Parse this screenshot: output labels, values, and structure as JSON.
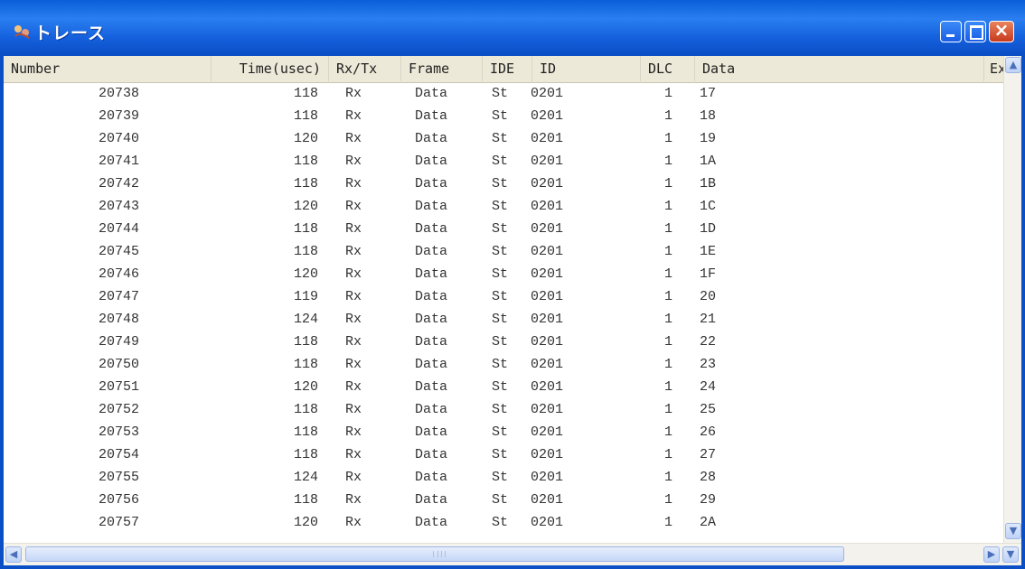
{
  "window": {
    "title": "トレース"
  },
  "columns": {
    "number": "Number",
    "time": "Time(usec)",
    "rxtx": "Rx/Tx",
    "frame": "Frame",
    "ide": "IDE",
    "id": "ID",
    "dlc": "DLC",
    "data": "Data",
    "extra": "Ex"
  },
  "rows": [
    {
      "number": "20738",
      "time": "118",
      "rxtx": "Rx",
      "frame": "Data",
      "ide": "St",
      "id": "0201",
      "dlc": "1",
      "data": "17"
    },
    {
      "number": "20739",
      "time": "118",
      "rxtx": "Rx",
      "frame": "Data",
      "ide": "St",
      "id": "0201",
      "dlc": "1",
      "data": "18"
    },
    {
      "number": "20740",
      "time": "120",
      "rxtx": "Rx",
      "frame": "Data",
      "ide": "St",
      "id": "0201",
      "dlc": "1",
      "data": "19"
    },
    {
      "number": "20741",
      "time": "118",
      "rxtx": "Rx",
      "frame": "Data",
      "ide": "St",
      "id": "0201",
      "dlc": "1",
      "data": "1A"
    },
    {
      "number": "20742",
      "time": "118",
      "rxtx": "Rx",
      "frame": "Data",
      "ide": "St",
      "id": "0201",
      "dlc": "1",
      "data": "1B"
    },
    {
      "number": "20743",
      "time": "120",
      "rxtx": "Rx",
      "frame": "Data",
      "ide": "St",
      "id": "0201",
      "dlc": "1",
      "data": "1C"
    },
    {
      "number": "20744",
      "time": "118",
      "rxtx": "Rx",
      "frame": "Data",
      "ide": "St",
      "id": "0201",
      "dlc": "1",
      "data": "1D"
    },
    {
      "number": "20745",
      "time": "118",
      "rxtx": "Rx",
      "frame": "Data",
      "ide": "St",
      "id": "0201",
      "dlc": "1",
      "data": "1E"
    },
    {
      "number": "20746",
      "time": "120",
      "rxtx": "Rx",
      "frame": "Data",
      "ide": "St",
      "id": "0201",
      "dlc": "1",
      "data": "1F"
    },
    {
      "number": "20747",
      "time": "119",
      "rxtx": "Rx",
      "frame": "Data",
      "ide": "St",
      "id": "0201",
      "dlc": "1",
      "data": "20"
    },
    {
      "number": "20748",
      "time": "124",
      "rxtx": "Rx",
      "frame": "Data",
      "ide": "St",
      "id": "0201",
      "dlc": "1",
      "data": "21"
    },
    {
      "number": "20749",
      "time": "118",
      "rxtx": "Rx",
      "frame": "Data",
      "ide": "St",
      "id": "0201",
      "dlc": "1",
      "data": "22"
    },
    {
      "number": "20750",
      "time": "118",
      "rxtx": "Rx",
      "frame": "Data",
      "ide": "St",
      "id": "0201",
      "dlc": "1",
      "data": "23"
    },
    {
      "number": "20751",
      "time": "120",
      "rxtx": "Rx",
      "frame": "Data",
      "ide": "St",
      "id": "0201",
      "dlc": "1",
      "data": "24"
    },
    {
      "number": "20752",
      "time": "118",
      "rxtx": "Rx",
      "frame": "Data",
      "ide": "St",
      "id": "0201",
      "dlc": "1",
      "data": "25"
    },
    {
      "number": "20753",
      "time": "118",
      "rxtx": "Rx",
      "frame": "Data",
      "ide": "St",
      "id": "0201",
      "dlc": "1",
      "data": "26"
    },
    {
      "number": "20754",
      "time": "118",
      "rxtx": "Rx",
      "frame": "Data",
      "ide": "St",
      "id": "0201",
      "dlc": "1",
      "data": "27"
    },
    {
      "number": "20755",
      "time": "124",
      "rxtx": "Rx",
      "frame": "Data",
      "ide": "St",
      "id": "0201",
      "dlc": "1",
      "data": "28"
    },
    {
      "number": "20756",
      "time": "118",
      "rxtx": "Rx",
      "frame": "Data",
      "ide": "St",
      "id": "0201",
      "dlc": "1",
      "data": "29"
    },
    {
      "number": "20757",
      "time": "120",
      "rxtx": "Rx",
      "frame": "Data",
      "ide": "St",
      "id": "0201",
      "dlc": "1",
      "data": "2A"
    }
  ],
  "icons": {
    "window": "trace-app-icon",
    "minimize": "minimize-icon",
    "maximize": "maximize-icon",
    "close": "close-icon",
    "scroll_up": "scroll-up-arrow-icon",
    "scroll_down": "scroll-down-arrow-icon",
    "scroll_left": "scroll-left-arrow-icon",
    "scroll_right": "scroll-right-arrow-icon"
  },
  "glyphs": {
    "close": "×",
    "up": "▲",
    "down": "▼",
    "left": "◀",
    "right": "▶"
  },
  "colors": {
    "titlebar": "#0b56d6",
    "close_button": "#d8542f",
    "header_bg": "#ece9d8",
    "text": "#333333"
  }
}
